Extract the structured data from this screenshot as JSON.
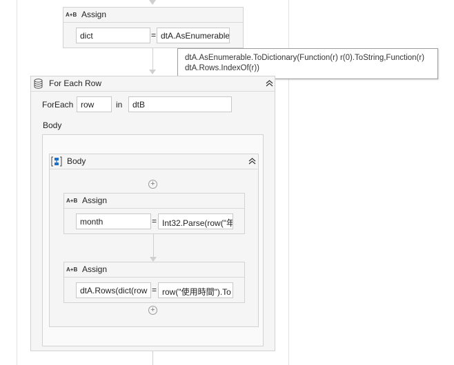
{
  "top_assign": {
    "title": "Assign",
    "icon": "A+B",
    "to": "dict",
    "equals": "=",
    "value": "dtA.AsEnumerable"
  },
  "tooltip": {
    "line1": "dtA.AsEnumerable.ToDictionary(Function(r) r(0).ToString,Function(r)",
    "line2": "dtA.Rows.IndexOf(r))"
  },
  "foreach": {
    "title": "For Each Row",
    "foreach_label": "ForEach",
    "item": "row",
    "in_label": "in",
    "collection": "dtB",
    "body_label": "Body",
    "sequence": {
      "title": "Body",
      "assign1": {
        "title": "Assign",
        "icon": "A+B",
        "to": "month",
        "equals": "=",
        "value": "Int32.Parse(row(\"年"
      },
      "assign2": {
        "title": "Assign",
        "icon": "A+B",
        "to": "dtA.Rows(dict(row",
        "equals": "=",
        "value": "row(\"使用時間\").To"
      }
    }
  },
  "colors": {
    "panel_bg": "#f5f5f5",
    "border": "#d2d2d2",
    "connector": "#cfcfcf",
    "sequence_icon": "#1f6fc5"
  }
}
